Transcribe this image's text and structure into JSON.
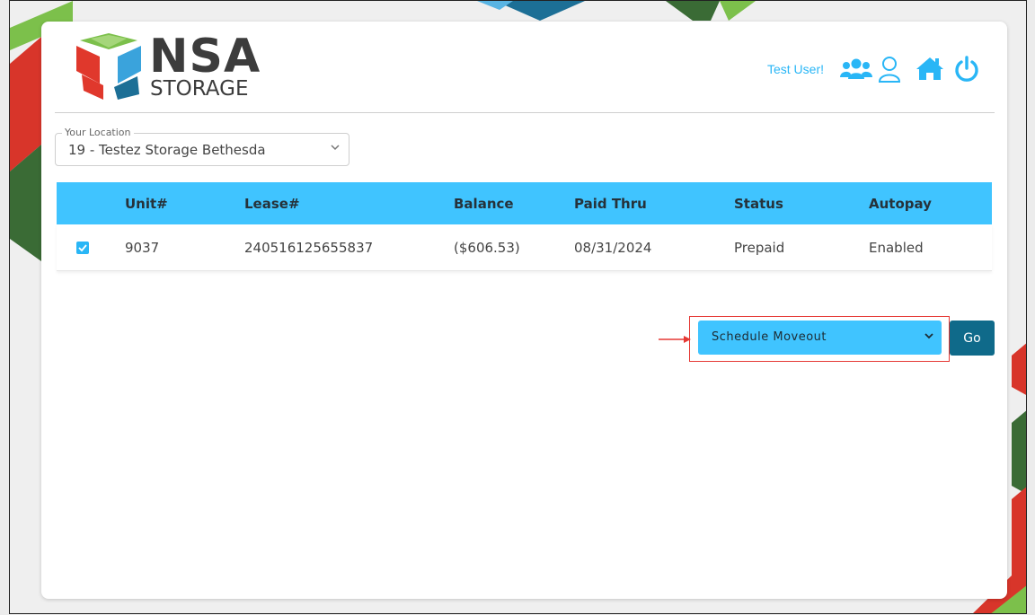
{
  "brand": {
    "name": "NSA",
    "sub": "STORAGE"
  },
  "header": {
    "user_greeting": "Test User!",
    "icons": [
      "users-icon",
      "user-icon",
      "home-icon",
      "power-icon"
    ]
  },
  "location": {
    "legend": "Your Location",
    "selected": "19 - Testez Storage Bethesda"
  },
  "table": {
    "columns": [
      "Unit#",
      "Lease#",
      "Balance",
      "Paid Thru",
      "Status",
      "Autopay"
    ],
    "rows": [
      {
        "checked": true,
        "unit": "9037",
        "lease": "240516125655837",
        "balance": "($606.53)",
        "paid_thru": "08/31/2024",
        "status": "Prepaid",
        "autopay": "Enabled"
      }
    ]
  },
  "actions": {
    "selected": "Schedule Moveout",
    "go_label": "Go"
  },
  "colors": {
    "accent": "#40c4ff",
    "icon_blue": "#29b6f6",
    "go_button": "#0f6a8a",
    "annotation": "#e53935"
  }
}
